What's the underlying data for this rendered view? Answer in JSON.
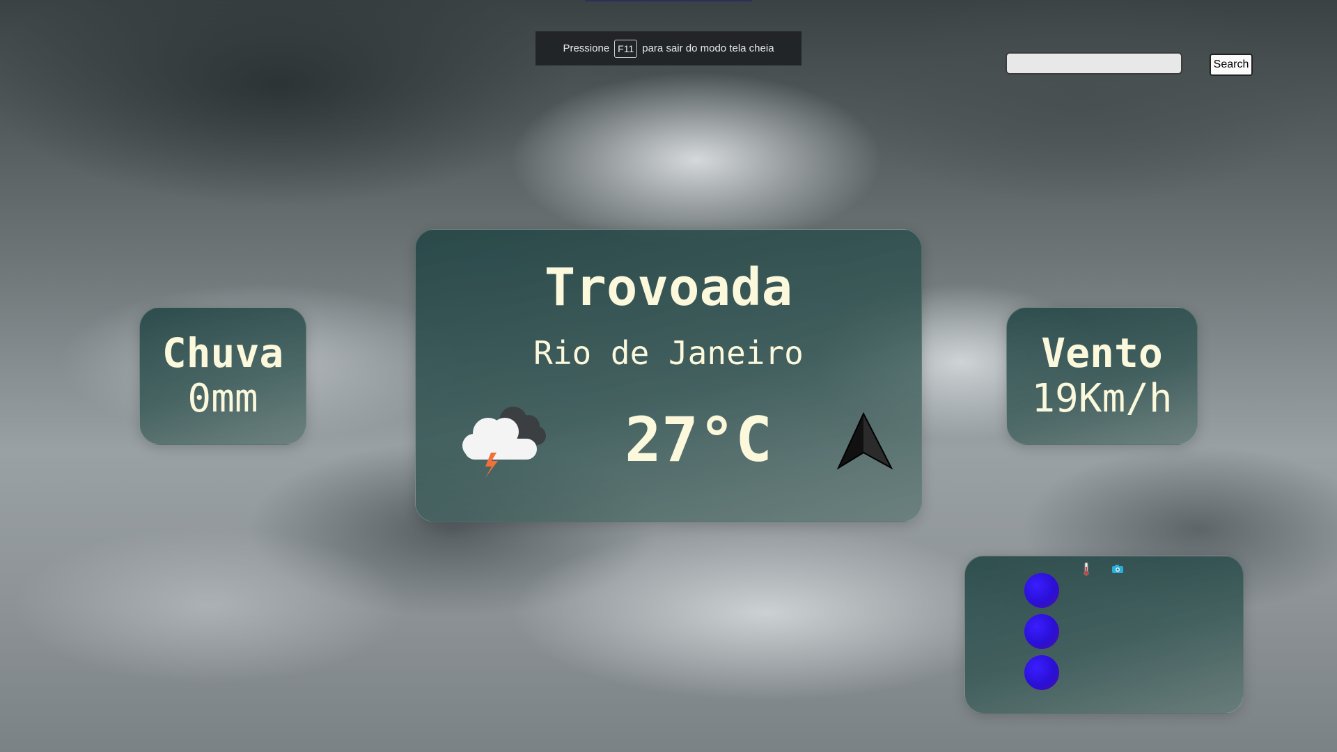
{
  "fullscreen_notice": {
    "prefix": "Pressione",
    "key": "F11",
    "suffix": "para sair do modo tela cheia"
  },
  "search": {
    "value": "",
    "placeholder": "",
    "button_label": "Search"
  },
  "rain": {
    "label": "Chuva",
    "value": "0mm"
  },
  "main": {
    "condition": "Trovoada",
    "city": "Rio de Janeiro",
    "temperature": "27°C",
    "condition_icon": "thunderstorm-icon",
    "wind_direction_icon": "navigation-arrow-icon"
  },
  "wind": {
    "label": "Vento",
    "value": "19Km/h"
  },
  "forecast": {
    "header_icons": [
      "thermometer-icon",
      "camera-icon"
    ],
    "dots": 3,
    "dot_color": "#2a0fd6"
  },
  "colors": {
    "card_text": "#fbf8dc",
    "card_bg": "#2b4b4a",
    "lightning": "#f0703a"
  }
}
